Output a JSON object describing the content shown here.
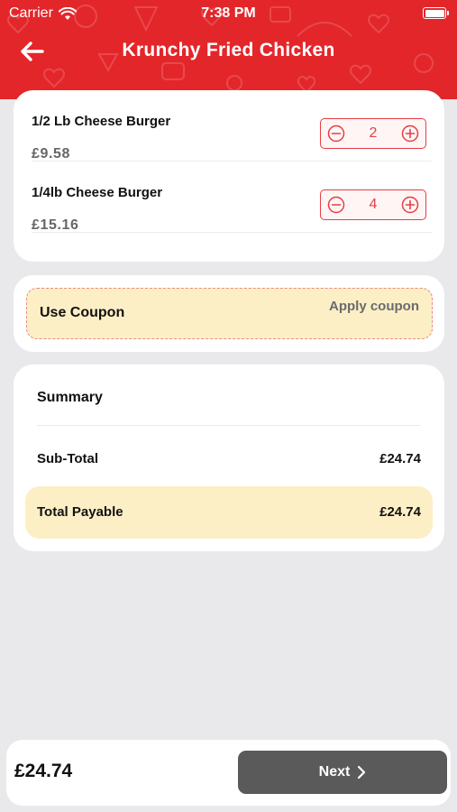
{
  "status_bar": {
    "carrier": "Carrier",
    "time": "7:38 PM",
    "wifi_icon": "wifi-icon",
    "battery_icon": "battery-icon"
  },
  "header": {
    "title": "Krunchy Fried Chicken",
    "back_icon": "arrow-left-icon",
    "color": "#e3262a"
  },
  "cart": {
    "items": [
      {
        "name": "1/2 Lb Cheese Burger",
        "price": "£9.58",
        "quantity": "2"
      },
      {
        "name": "1/4lb Cheese Burger",
        "price": "£15.16",
        "quantity": "4"
      }
    ],
    "minus_icon": "minus-circle-icon",
    "plus_icon": "plus-circle-icon"
  },
  "coupon": {
    "title": "Use Coupon",
    "action_label": "Apply coupon"
  },
  "summary": {
    "title": "Summary",
    "subtotal_label": "Sub-Total",
    "subtotal_value": "£24.74",
    "total_label": "Total Payable",
    "total_value": "£24.74"
  },
  "footer": {
    "amount": "£24.74",
    "next_label": "Next",
    "next_icon": "chevron-right-icon"
  },
  "colors": {
    "accent": "#e3262a",
    "stepper": "#e53e44",
    "highlight": "#fcefc6",
    "button": "#5a5a5a",
    "background": "#e9e9ec"
  }
}
